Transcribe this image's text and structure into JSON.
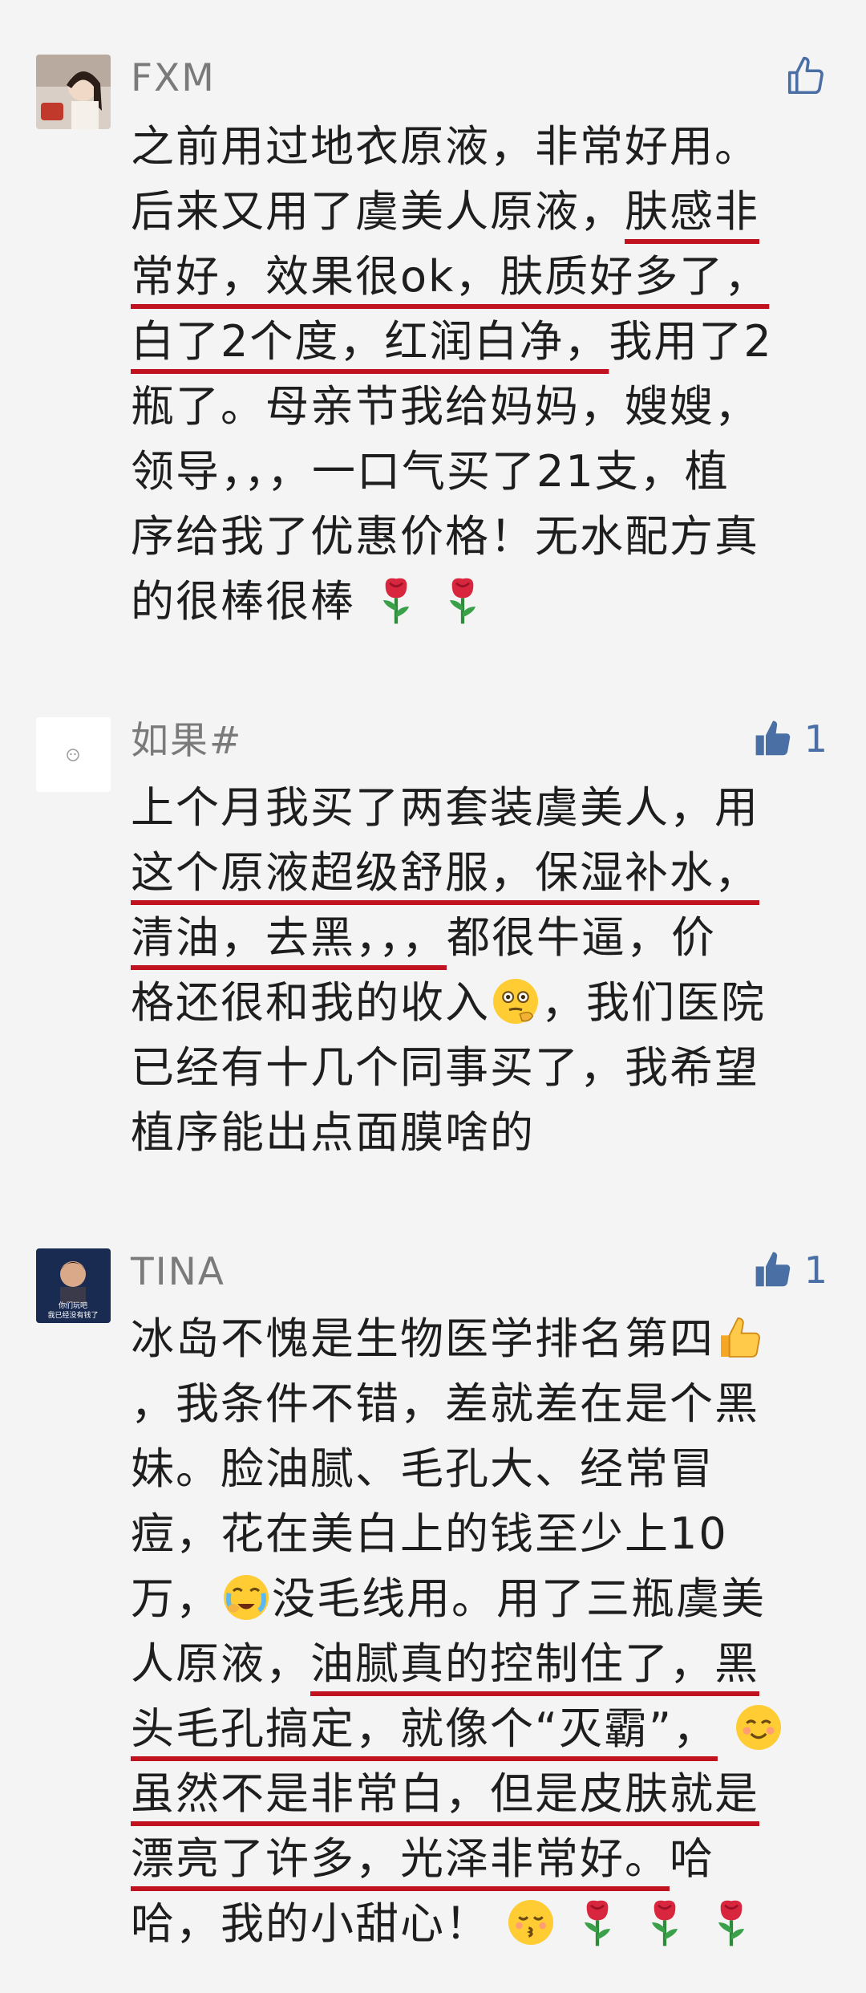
{
  "comments": [
    {
      "name": "FXM",
      "likes": "",
      "lines": [
        [
          {
            "t": "之前用过地衣原液，非常好用。"
          }
        ],
        [
          {
            "t": "后来又用了虞美人原液，"
          },
          {
            "t": "肤感非",
            "u": true
          }
        ],
        [
          {
            "t": "常好，效果很ok，肤质好多了，",
            "u": true
          }
        ],
        [
          {
            "t": "白了2个度，红润白净，",
            "u": true
          },
          {
            "t": "我用了2"
          }
        ],
        [
          {
            "t": "瓶了。母亲节我给妈妈，嫂嫂，"
          }
        ],
        [
          {
            "t": "领导，，，一口气买了21支，植"
          }
        ],
        [
          {
            "t": "序给我了优惠价格！无水配方真"
          }
        ],
        [
          {
            "t": "的很棒很棒 "
          },
          {
            "e": "rose-emoji"
          },
          {
            "t": " "
          },
          {
            "e": "rose-emoji"
          }
        ]
      ]
    },
    {
      "name": "如果#",
      "likes": "1",
      "lines": [
        [
          {
            "t": "上个月我买了两套装虞美人，用"
          }
        ],
        [
          {
            "t": "这个原液超级舒服，保湿补水，",
            "u": true
          }
        ],
        [
          {
            "t": "清油，去黑，，，",
            "u": true
          },
          {
            "t": "都很牛逼，价"
          }
        ],
        [
          {
            "t": "格还很和我的收入"
          },
          {
            "e": "thinking-face-emoji"
          },
          {
            "t": "，我们医院"
          }
        ],
        [
          {
            "t": "已经有十几个同事买了，我希望"
          }
        ],
        [
          {
            "t": "植序能出点面膜啥的"
          }
        ]
      ]
    },
    {
      "name": "TINA",
      "likes": "1",
      "avatar_caption": [
        "你们玩吧",
        "我已经没有钱了"
      ],
      "lines": [
        [
          {
            "t": "冰岛不愧是生物医学排名第四"
          },
          {
            "e": "thumbs-up-emoji"
          }
        ],
        [
          {
            "t": "，我条件不错，差就差在是个黑"
          }
        ],
        [
          {
            "t": "妹。脸油腻、毛孔大、经常冒"
          }
        ],
        [
          {
            "t": "痘，花在美白上的钱至少上10"
          }
        ],
        [
          {
            "t": "万，"
          },
          {
            "e": "crying-face-emoji"
          },
          {
            "t": "没毛线用。用了三瓶虞美"
          }
        ],
        [
          {
            "t": "人原液，"
          },
          {
            "t": "油腻真的控制住了，黑",
            "u": true
          }
        ],
        [
          {
            "t": "头毛孔搞定，就像个“灭霸”，",
            "u": true
          },
          {
            "t": " "
          },
          {
            "e": "smiling-face-emoji"
          }
        ],
        [
          {
            "t": "虽然不是非常白，但是皮肤就是",
            "u": true
          }
        ],
        [
          {
            "t": "漂亮了许多，光泽非常好。",
            "u": true
          },
          {
            "t": "哈"
          }
        ],
        [
          {
            "t": "哈，我的小甜心！ "
          },
          {
            "e": "kissing-face-emoji"
          },
          {
            "t": " "
          },
          {
            "e": "rose-emoji"
          },
          {
            "t": " "
          },
          {
            "e": "rose-emoji"
          },
          {
            "t": " "
          },
          {
            "e": "rose-emoji"
          }
        ]
      ]
    }
  ],
  "colors": {
    "underline": "#c1121f",
    "like": "#4a6fa5",
    "name": "#7a7a7a"
  }
}
